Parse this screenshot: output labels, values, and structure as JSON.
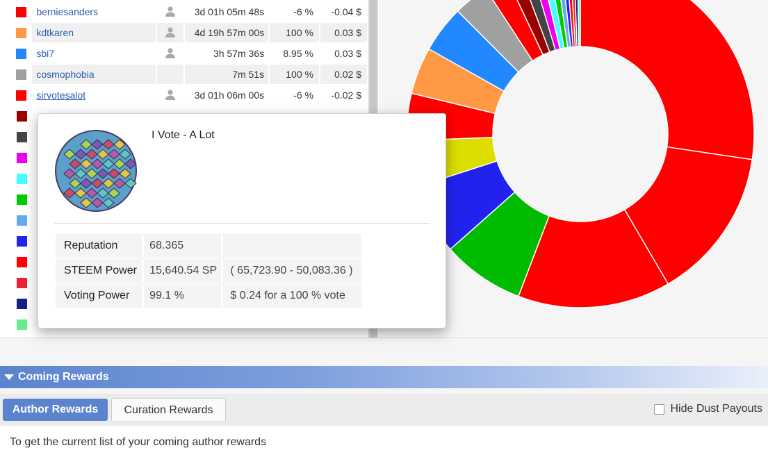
{
  "voters": [
    {
      "name": "berniesanders",
      "color": "#ff0000",
      "has_icon": true,
      "time": "3d 01h 05m 48s",
      "pct": "-6 %",
      "reward": "-0.04 $",
      "underline": false
    },
    {
      "name": "kdtkaren",
      "color": "#ff9944",
      "has_icon": true,
      "time": "4d 19h 57m 00s",
      "pct": "100 %",
      "reward": "0.03 $",
      "underline": false
    },
    {
      "name": "sbi7",
      "color": "#2288ff",
      "has_icon": true,
      "time": "3h 57m 36s",
      "pct": "8.95 %",
      "reward": "0.03 $",
      "underline": false
    },
    {
      "name": "cosmophobia",
      "color": "#a0a0a0",
      "has_icon": false,
      "time": "7m 51s",
      "pct": "100 %",
      "reward": "0.02 $",
      "underline": false
    },
    {
      "name": "sirvotesalot",
      "color": "#ff0000",
      "has_icon": true,
      "time": "3d 01h 06m 00s",
      "pct": "-6 %",
      "reward": "-0.02 $",
      "underline": true
    }
  ],
  "hidden_swatches": [
    "#990000",
    "#444444",
    "#ee00ee",
    "#44ffff",
    "#00cc00",
    "#66aaee",
    "#2222ee",
    "#ff0000",
    "#ee2233",
    "#112288",
    "#66ee88"
  ],
  "tooltip": {
    "account_title": "I Vote - A Lot",
    "rows": [
      {
        "key": "Reputation",
        "value": "68.365",
        "extra": ""
      },
      {
        "key": "STEEM Power",
        "value": "15,640.54 SP",
        "extra": "( 65,723.90 - 50,083.36 )"
      },
      {
        "key": "Voting Power",
        "value": "99.1 %",
        "extra": "$ 0.24 for a 100 % vote"
      }
    ]
  },
  "chart_data": {
    "type": "pie",
    "style": "donut",
    "slices": [
      {
        "color": "#ff0000",
        "value": 25
      },
      {
        "color": "#ff0000",
        "value": 13
      },
      {
        "color": "#ff0000",
        "value": 13
      },
      {
        "color": "#00bb00",
        "value": 7
      },
      {
        "color": "#2222ee",
        "value": 6
      },
      {
        "color": "#dddd00",
        "value": 4
      },
      {
        "color": "#ff0000",
        "value": 4
      },
      {
        "color": "#ff9944",
        "value": 4
      },
      {
        "color": "#2288ff",
        "value": 4
      },
      {
        "color": "#a0a0a0",
        "value": 3
      },
      {
        "color": "#ff0000",
        "value": 2
      },
      {
        "color": "#990000",
        "value": 1.2
      },
      {
        "color": "#444444",
        "value": 1
      },
      {
        "color": "#ee00ee",
        "value": 0.8
      },
      {
        "color": "#44ffff",
        "value": 0.7
      },
      {
        "color": "#00cc00",
        "value": 0.6
      },
      {
        "color": "#66aaee",
        "value": 0.5
      },
      {
        "color": "#2222ee",
        "value": 0.4
      },
      {
        "color": "#ff0000",
        "value": 0.35
      },
      {
        "color": "#ee2233",
        "value": 0.3
      },
      {
        "color": "#112288",
        "value": 0.3
      },
      {
        "color": "#66ee88",
        "value": 0.25
      }
    ]
  },
  "coming_rewards": {
    "title": "Coming Rewards",
    "tab_author": "Author Rewards",
    "tab_curation": "Curation Rewards",
    "hide_dust": "Hide Dust Payouts",
    "help_line1": "To get the current list of your coming author rewards"
  }
}
